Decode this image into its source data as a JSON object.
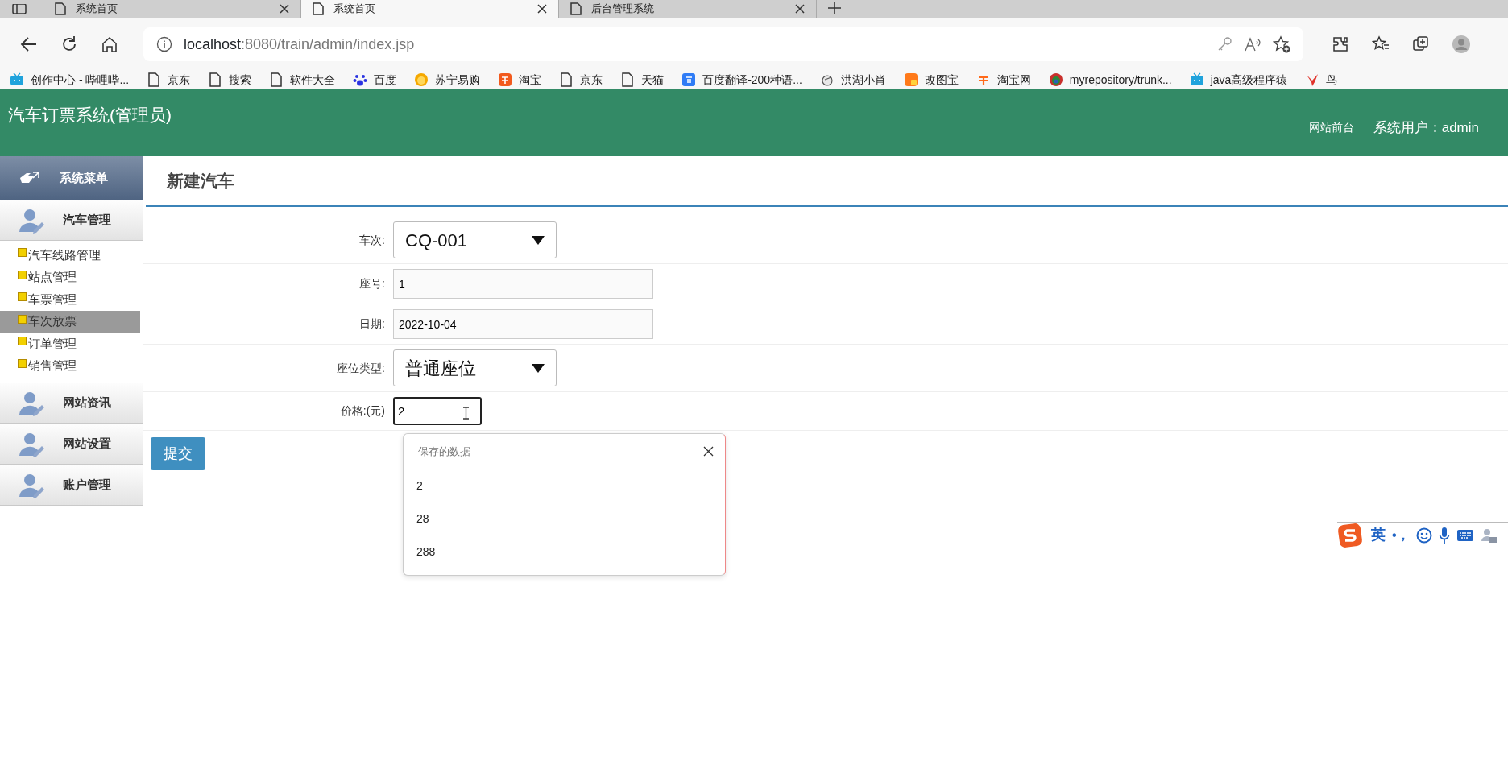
{
  "browser": {
    "tabs": [
      {
        "title": "系统首页",
        "selected": false
      },
      {
        "title": "系统首页",
        "selected": true
      },
      {
        "title": "后台管理系统",
        "selected": false
      }
    ],
    "url": {
      "host": "localhost",
      "rest": ":8080/train/admin/index.jsp"
    },
    "bookmarks": [
      {
        "label": "创作中心 - 哔哩哔..."
      },
      {
        "label": "京东"
      },
      {
        "label": "搜索"
      },
      {
        "label": "软件大全"
      },
      {
        "label": "百度"
      },
      {
        "label": "苏宁易购"
      },
      {
        "label": "淘宝"
      },
      {
        "label": "京东"
      },
      {
        "label": "天猫"
      },
      {
        "label": "百度翻译-200种语..."
      },
      {
        "label": "洪湖小肖"
      },
      {
        "label": "改图宝"
      },
      {
        "label": "淘宝网"
      },
      {
        "label": "myrepository/trunk..."
      },
      {
        "label": "java高级程序猿"
      },
      {
        "label": "鸟"
      }
    ]
  },
  "header": {
    "title": "汽车订票系统(管理员)",
    "link": "网站前台",
    "user": "系统用户：admin"
  },
  "sidebar": {
    "title": "系统菜单",
    "groups": [
      {
        "label": "汽车管理",
        "items": [
          {
            "label": "汽车线路管理",
            "selected": false
          },
          {
            "label": "站点管理",
            "selected": false
          },
          {
            "label": "车票管理",
            "selected": false
          },
          {
            "label": "车次放票",
            "selected": true
          },
          {
            "label": "订单管理",
            "selected": false
          },
          {
            "label": "销售管理",
            "selected": false
          }
        ]
      },
      {
        "label": "网站资讯"
      },
      {
        "label": "网站设置"
      },
      {
        "label": "账户管理"
      }
    ]
  },
  "form": {
    "title": "新建汽车",
    "fields": [
      {
        "kind": "select",
        "label": "车次:",
        "value": "CQ-001"
      },
      {
        "kind": "text",
        "label": "座号:",
        "value": "1"
      },
      {
        "kind": "text",
        "label": "日期:",
        "value": "2022-10-04"
      },
      {
        "kind": "select",
        "label": "座位类型:",
        "value": "普通座位"
      },
      {
        "kind": "focused",
        "label": "价格:(元)",
        "value": "2"
      }
    ],
    "submit": "提交"
  },
  "autocomplete": {
    "title": "保存的数据",
    "options": [
      "2",
      "28",
      "288"
    ]
  },
  "ime": {
    "mode": "英",
    "punct": "•，"
  }
}
